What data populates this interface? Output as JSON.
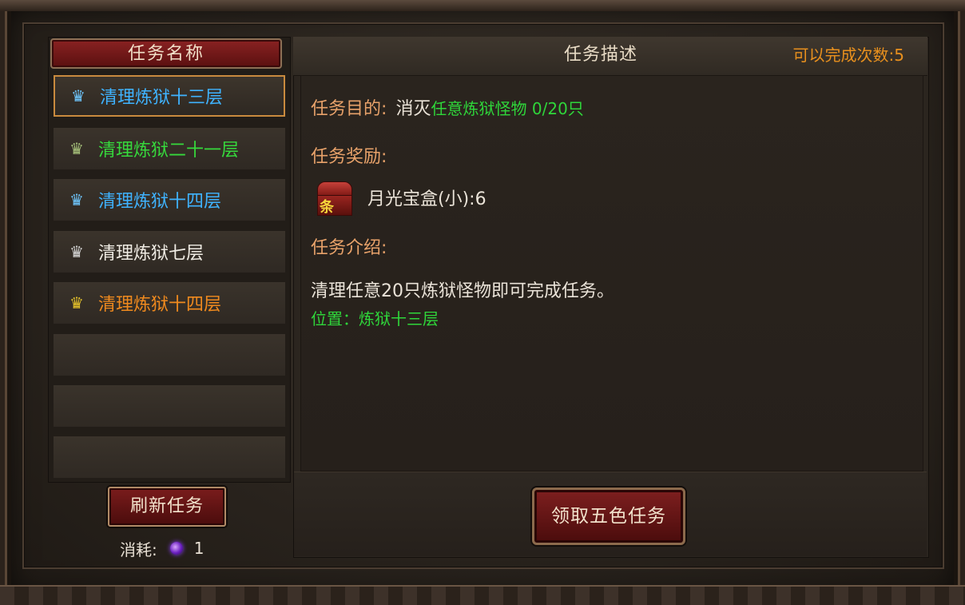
{
  "left": {
    "header": "任务名称",
    "quests": [
      {
        "name": "清理炼狱十三层",
        "color": "#3fb3ff",
        "crown_color": "#6fc8ff",
        "selected": true
      },
      {
        "name": "清理炼狱二十一层",
        "color": "#36d93c",
        "crown_color": "#a9c47c",
        "selected": false
      },
      {
        "name": "清理炼狱十四层",
        "color": "#3fb3ff",
        "crown_color": "#6fc8ff",
        "selected": false
      },
      {
        "name": "清理炼狱七层",
        "color": "#f0ece4",
        "crown_color": "#d8d8d8",
        "selected": false
      },
      {
        "name": "清理炼狱十四层",
        "color": "#f08a1e",
        "crown_color": "#e8c42a",
        "selected": false
      }
    ],
    "refresh_label": "刷新任务",
    "cost_label": "消耗:",
    "cost_value": "1"
  },
  "right": {
    "title": "任务描述",
    "can_complete": "可以完成次数:5",
    "purpose_label": "任务目的:",
    "purpose_prefix": "消灭",
    "purpose_target": "任意炼狱怪物 0/20只",
    "reward_label": "任务奖励:",
    "reward_item": "月光宝盒(小):6",
    "intro_label": "任务介绍:",
    "intro_text": "清理任意20只炼狱怪物即可完成任务。",
    "location": "位置：炼狱十三层",
    "accept_label": "领取五色任务"
  }
}
